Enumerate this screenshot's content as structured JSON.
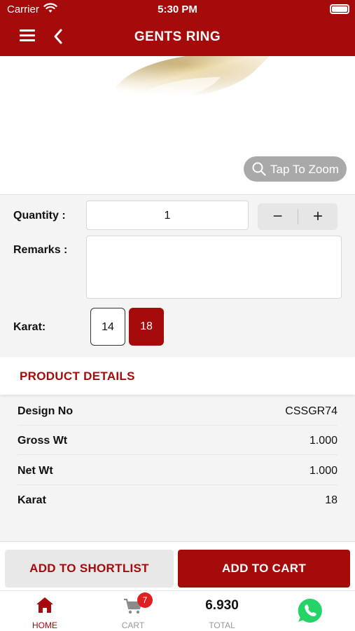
{
  "status_bar": {
    "carrier": "Carrier",
    "time": "5:30 PM"
  },
  "nav": {
    "title": "GENTS RING"
  },
  "image": {
    "zoom_label": "Tap To Zoom"
  },
  "form": {
    "quantity_label": "Quantity :",
    "quantity_value": "1",
    "minus": "−",
    "plus": "+",
    "remarks_label": "Remarks :",
    "remarks_value": "",
    "karat_label": "Karat:",
    "karat_options": [
      "14",
      "18"
    ],
    "karat_selected": "18"
  },
  "product_details": {
    "title": "PRODUCT DETAILS",
    "rows": [
      {
        "key": "Design No",
        "value": "CSSGR74"
      },
      {
        "key": "Gross Wt",
        "value": "1.000"
      },
      {
        "key": "Net Wt",
        "value": "1.000"
      },
      {
        "key": "Karat",
        "value": "18"
      }
    ]
  },
  "actions": {
    "shortlist": "ADD TO SHORTLIST",
    "add_to_cart": "ADD TO CART"
  },
  "tabbar": {
    "home": "HOME",
    "cart": "CART",
    "cart_count": "7",
    "total_value": "6.930",
    "total_label": "TOTAL"
  },
  "colors": {
    "brand": "#a50b0b",
    "badge": "#e02020",
    "whatsapp": "#25d366"
  },
  "icons": [
    "wifi-icon",
    "battery-icon",
    "menu-icon",
    "back-icon",
    "search-icon",
    "home-icon",
    "cart-icon",
    "whatsapp-icon"
  ]
}
